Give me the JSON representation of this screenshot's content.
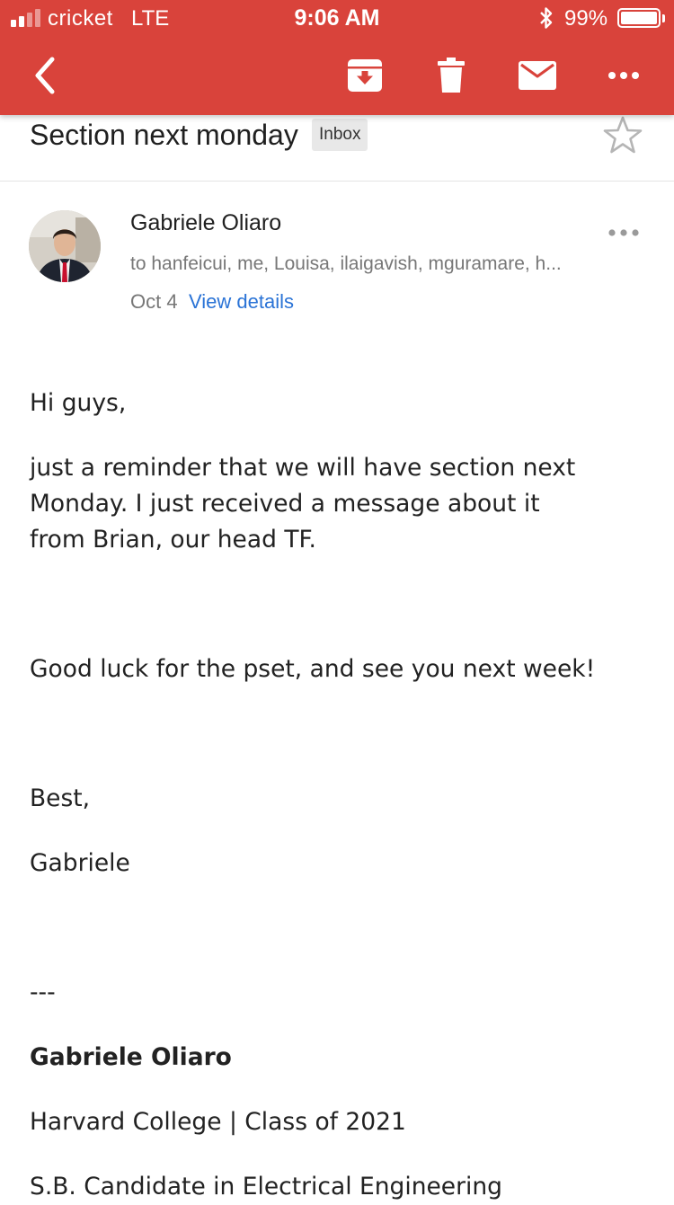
{
  "status_bar": {
    "carrier": "cricket",
    "network": "LTE",
    "time": "9:06 AM",
    "battery_percent": "99%",
    "signal_bars_filled": 2,
    "signal_bars_total": 4,
    "battery_level": 0.99
  },
  "toolbar": {
    "background_color": "#d9433b",
    "icons": [
      "back-icon",
      "archive-icon",
      "trash-icon",
      "mail-icon",
      "more-icon"
    ]
  },
  "email": {
    "subject": "Section next monday",
    "label": "Inbox",
    "sender": "Gabriele Oliaro",
    "recipients": "to hanfeicui, me, Louisa, ilaigavish, mguramare, h...",
    "date": "Oct 4",
    "view_details": "View details",
    "body": {
      "greeting": "Hi guys,",
      "para1_line1": "just a reminder that we will have section next",
      "para1_line2": "Monday. I just received a message about it",
      "para1_line3": "from Brian, our head TF.",
      "para2": "Good luck for the pset, and see you next week!",
      "closing": "Best,",
      "name": "Gabriele",
      "separator": "---",
      "sig_name": "Gabriele Oliaro",
      "sig_line1": "Harvard College | Class of 2021",
      "sig_line2": "S.B. Candidate in Electrical Engineering"
    }
  },
  "colors": {
    "accent": "#d9433b",
    "link": "#2a73d6",
    "secondary_text": "#777777"
  }
}
